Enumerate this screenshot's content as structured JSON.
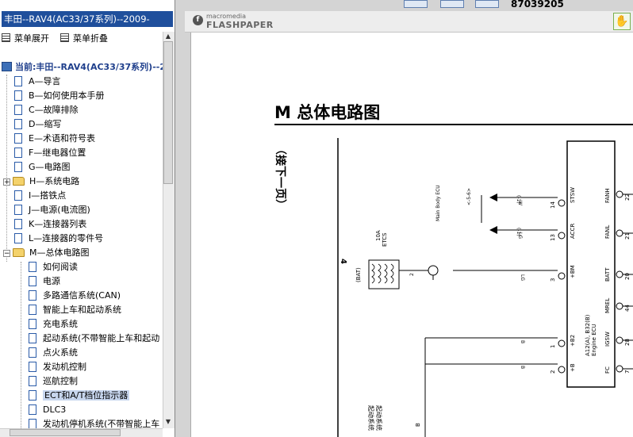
{
  "left_pane": {
    "title": "丰田--RAV4(AC33/37系列)--2009-",
    "toolbar": {
      "expand_label": "菜单展开",
      "collapse_label": "菜单折叠"
    },
    "root_label": "当前:丰田--RAV4(AC33/37系列)--2",
    "items": [
      {
        "label": "A—导言"
      },
      {
        "label": "B—如何使用本手册"
      },
      {
        "label": "C—故障排除"
      },
      {
        "label": "D—缩写"
      },
      {
        "label": "E—术语和符号表"
      },
      {
        "label": "F—继电器位置"
      },
      {
        "label": "G—电路图"
      },
      {
        "label": "H—系统电路"
      },
      {
        "label": "I—搭铁点"
      },
      {
        "label": "J—电源(电流图)"
      },
      {
        "label": "K—连接器列表"
      },
      {
        "label": "L—连接器的零件号"
      },
      {
        "label": "M—总体电路图"
      }
    ],
    "sub_items": [
      {
        "label": "如何阅读"
      },
      {
        "label": "电源"
      },
      {
        "label": "多路通信系统(CAN)"
      },
      {
        "label": "智能上车和起动系统"
      },
      {
        "label": "充电系统"
      },
      {
        "label": "起动系统(不带智能上车和起动"
      },
      {
        "label": "点火系统"
      },
      {
        "label": "发动机控制"
      },
      {
        "label": "巡航控制"
      },
      {
        "label": "ECT和A/T档位指示器"
      },
      {
        "label": "DLC3"
      },
      {
        "label": "发动机停机系统(不带智能上车"
      }
    ],
    "selected": "ECT和A/T档位指示器"
  },
  "viewer": {
    "top_number": "87039205",
    "brand_small": "macromedia",
    "brand_big": "FLASHPAPER",
    "hand_tool_icon": "hand-icon"
  },
  "diagram": {
    "heading": "M 总体电路图",
    "side_note": "（接下一页）",
    "marker_4": "4",
    "fuse_label_1": "10A",
    "fuse_label_2": "ETCS",
    "fuse_tag": "(BAT)",
    "fuse_pin": "2",
    "ecu_name_1": "A12(A), B32(B)",
    "ecu_name_2": "Engine ECU",
    "main_body_ecu": "Main Body ECU",
    "wire_lg1": "W",
    "wire_lg2": "LG",
    "wire_lg3": "LG",
    "wire_b1": "B",
    "wire_b2": "B",
    "wire_b3": "B",
    "pin_left": [
      {
        "num": "14",
        "conn": "(A)",
        "name": "STSW"
      },
      {
        "num": "13",
        "conn": "(A)",
        "name": "ACCR"
      },
      {
        "num": "3",
        "conn": "(A)",
        "name": "+BM"
      },
      {
        "num": "1",
        "conn": "(A)",
        "name": "+B2"
      },
      {
        "num": "2",
        "conn": "(A)",
        "name": "+B"
      }
    ],
    "pin_right": [
      {
        "num": "22",
        "conn": "(A)",
        "name": "FANH"
      },
      {
        "num": "21",
        "conn": "(A)",
        "name": "FANL"
      },
      {
        "num": "20",
        "conn": "(A)",
        "name": "BATT"
      },
      {
        "num": "44",
        "conn": "(A)",
        "name": "MREL"
      },
      {
        "num": "28",
        "conn": "(A)",
        "name": "IGSW"
      },
      {
        "num": "7",
        "conn": "(A)",
        "name": "FC"
      }
    ],
    "arrow_tag_1": "(-1)",
    "arrow_tag_2": "(-1)",
    "conn_tag": "<-5-6>",
    "bottom_vert_1": "起动系统",
    "bottom_vert_2": "起动系统"
  }
}
